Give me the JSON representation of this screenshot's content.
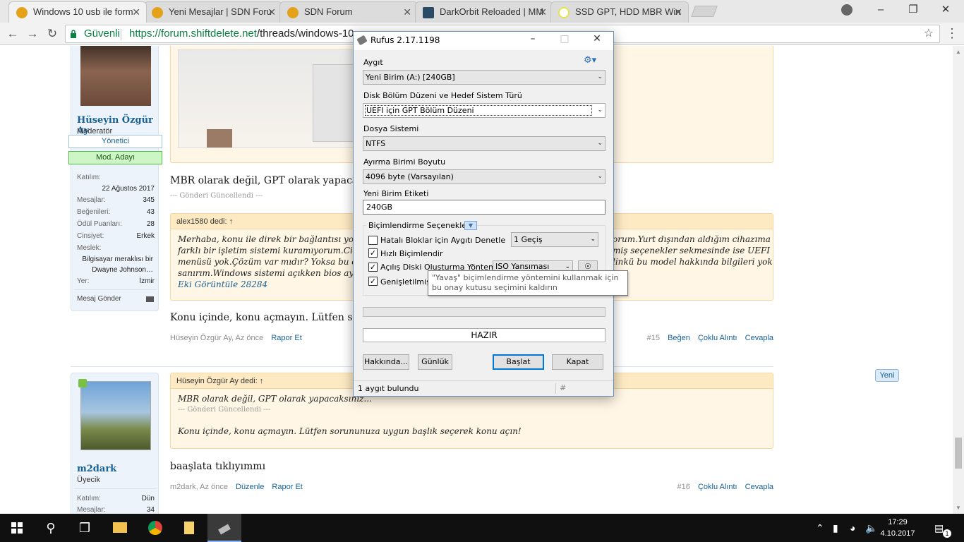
{
  "browser": {
    "tabs": [
      {
        "title": "Windows 10 usb ile form",
        "active": true,
        "favicon_color": "#e3a21a"
      },
      {
        "title": "Yeni Mesajlar | SDN Foru",
        "active": false,
        "favicon_color": "#e3a21a"
      },
      {
        "title": "SDN Forum",
        "active": false,
        "favicon_color": "#e3a21a"
      },
      {
        "title": "DarkOrbit Reloaded | MM",
        "active": false,
        "favicon_color": "#2b4a66"
      },
      {
        "title": "SSD GPT, HDD MBR Win",
        "active": false,
        "favicon_color": "#e7e34c"
      }
    ],
    "secure_label": "Güvenli",
    "url_host": "https://forum.shiftdelete.net",
    "url_path": "/threads/windows-10-u",
    "tab_close": "✕",
    "window_controls": {
      "minimize": "–",
      "maximize": "❐",
      "close": "✕"
    }
  },
  "posts": [
    {
      "user": {
        "name": "Hüseyin Özgür Ay",
        "role": "Moderatör",
        "badge_primary": "Yönetici",
        "badge_secondary": "Mod. Adayı",
        "stats": [
          {
            "label": "Katılım:",
            "value": "22 Ağustos 2017"
          },
          {
            "label": "Mesajlar:",
            "value": "345"
          },
          {
            "label": "Beğenileri:",
            "value": "43"
          },
          {
            "label": "Ödül Puanları:",
            "value": "28"
          },
          {
            "label": "Cinsiyet:",
            "value": "Erkek"
          },
          {
            "label": "Meslek:",
            "value": "Bilgisayar meraklısı bir Dwayne Johnson…"
          },
          {
            "label": "Yer:",
            "value": "İzmir"
          }
        ],
        "send_message": "Mesaj Gönder"
      },
      "message_line": "MBR olarak değil, GPT olarak yapacaksı",
      "edited_note": "--- Gönderi Güncellendi ---",
      "quote": {
        "author": "alex1580 dedi: ↑",
        "lines": [
          "Merhaba, konu ile direk bir bağlantısı yok anc",
          "farklı bir işletim sistemi kuramıyorum.Cihaz A",
          "menüsü yok.Çözüm var mıdır? Yoksa bu cihaz",
          "sanırım.Windows sistemi açıkken bios ayarına"
        ],
        "lines_right": [
          "orum.Yurt dışından aldığım cihazıma",
          "miş seçenekler sekmesinde ise UEFI",
          "linkü bu model hakkında bilgileri yok"
        ],
        "expand_link": "Eki Görüntüle 28284"
      },
      "reply_line": "Konu içinde, konu açmayın. Lütfen soru",
      "meta_author": "Hüseyin Özgür Ay, Az önce",
      "meta_link": "Rapor Et",
      "number": "#15",
      "actions": [
        "Beğen",
        "Çoklu Alıntı",
        "Cevapla"
      ]
    },
    {
      "user": {
        "name": "m2dark",
        "role": "Üyecik",
        "stats": [
          {
            "label": "Katılım:",
            "value": "Dün"
          },
          {
            "label": "Mesajlar:",
            "value": "34"
          }
        ]
      },
      "quote": {
        "author": "Hüseyin Özgür Ay dedi: ↑",
        "line1": "MBR olarak değil, GPT olarak yapacaksınız...",
        "edited": "--- Gönderi Güncellendi ---",
        "line2": "Konu içinde, konu açmayın. Lütfen sorununuza uygun başlık seçerek konu açın!"
      },
      "message": "baaşlata tıklıyımmı",
      "meta_author": "m2dark, Az önce",
      "meta_links": [
        "Düzenle",
        "Rapor Et"
      ],
      "number": "#16",
      "actions": [
        "Çoklu Alıntı",
        "Cevapla"
      ],
      "new_tag": "Yeni"
    }
  ],
  "rufus": {
    "title": "Rufus 2.17.1198",
    "device_label": "Aygıt",
    "device_value": "Yeni Birim (A:) [240GB]",
    "partition_label": "Disk Bölüm Düzeni ve Hedef Sistem Türü",
    "partition_value": "UEFI için GPT Bölüm Düzeni",
    "fs_label": "Dosya Sistemi",
    "fs_value": "NTFS",
    "cluster_label": "Ayırma Birimi Boyutu",
    "cluster_value": "4096 byte (Varsayılan)",
    "volume_label_label": "Yeni Birim Etiketi",
    "volume_label_value": "240GB",
    "format_options_label": "Biçimlendirme Seçenekleri",
    "badblocks_label": "Hatalı Bloklar için Aygıtı Denetle",
    "badblocks_checked": false,
    "passes_value": "1 Geçiş",
    "quick_label": "Hızlı Biçimlendir",
    "quick_checked": true,
    "bootable_label": "Açılış Diski Oluşturma Yöntemi",
    "bootable_checked": true,
    "image_type": "ISO Yansıması",
    "extended_label": "Genişletilmiş",
    "extended_checked": true,
    "tooltip": "\"Yavaş\" biçimlendirme yöntemini kullanmak için bu onay kutusu seçimini kaldırın",
    "progress": 0,
    "status": "HAZIR",
    "about_button": "Hakkında...",
    "log_button": "Günlük",
    "start_button": "Başlat",
    "close_button": "Kapat",
    "statusbar": "1 aygıt bulundu",
    "hash": "#",
    "check": "✓"
  },
  "taskbar": {
    "time": "17:29",
    "date": "4.10.2017",
    "notification_count": "1"
  }
}
